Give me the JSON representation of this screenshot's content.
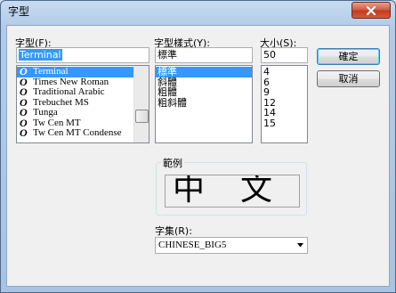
{
  "window": {
    "title": "字型"
  },
  "font": {
    "label": "字型(F):",
    "value": "Terminal",
    "items": [
      "Terminal",
      "Times New Roman",
      "Traditional Arabic",
      "Trebuchet MS",
      "Tunga",
      "Tw Cen MT",
      "Tw Cen MT Condense"
    ],
    "selected_index": 0
  },
  "style": {
    "label": "字型樣式(Y):",
    "value": "標準",
    "items": [
      "標準",
      "斜體",
      "粗體",
      "粗斜體"
    ],
    "selected_index": 0
  },
  "size": {
    "label": "大小(S):",
    "value": "50",
    "items": [
      "4",
      "6",
      "9",
      "12",
      "14",
      "15"
    ]
  },
  "buttons": {
    "ok": "確定",
    "cancel": "取消"
  },
  "sample": {
    "label": "範例",
    "text": "中文"
  },
  "charset": {
    "label": "字集(R):",
    "value": "CHINESE_BIG5"
  },
  "icons": {
    "close": "close-icon",
    "truetype": "truetype-icon",
    "dropdown": "chevron-down-icon"
  }
}
